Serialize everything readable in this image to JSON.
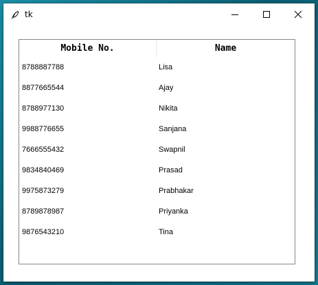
{
  "window": {
    "title": "tk",
    "icons": {
      "app": "feather-icon",
      "minimize": "minimize-icon",
      "maximize": "maximize-icon",
      "close": "close-icon"
    }
  },
  "table": {
    "columns": [
      "Mobile No.",
      "Name"
    ],
    "rows": [
      [
        "8788887788",
        "Lisa"
      ],
      [
        "8877665544",
        "Ajay"
      ],
      [
        "8788977130",
        "Nikita"
      ],
      [
        "9988776655",
        "Sanjana"
      ],
      [
        "7666555432",
        "Swapnil"
      ],
      [
        "9834840469",
        "Prasad"
      ],
      [
        "9975873279",
        "Prabhakar"
      ],
      [
        "8789878987",
        "Priyanka"
      ],
      [
        "9876543210",
        "Tina"
      ]
    ]
  }
}
